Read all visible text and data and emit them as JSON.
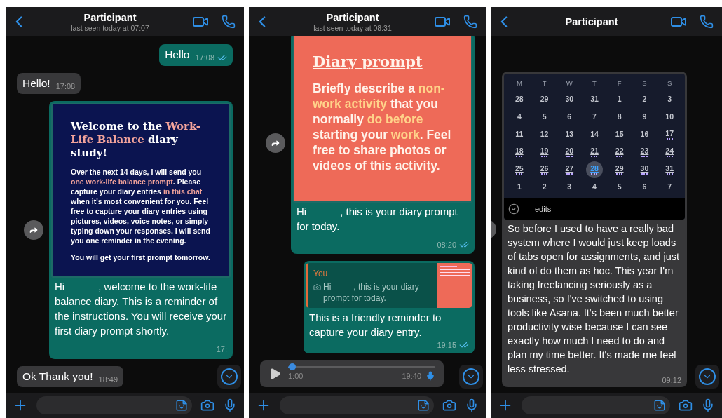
{
  "screens": [
    {
      "header": {
        "title": "Participant",
        "subtitle": "last seen today at 07:07"
      },
      "messages": [
        {
          "kind": "outgoing",
          "text": "Hello",
          "time": "17:08",
          "read": true
        },
        {
          "kind": "incoming",
          "text": "Hello!",
          "time": "17:08"
        },
        {
          "kind": "image",
          "card": {
            "title": [
              {
                "text": "Welcome to the "
              },
              {
                "text": "Work-Life Balance",
                "highlight": true
              },
              {
                "text": " diary study!"
              }
            ],
            "paragraphs": [
              [
                {
                  "text": "Over the next 14 days, I will send you "
                },
                {
                  "text": "one work-life balance prompt",
                  "highlight": true
                },
                {
                  "text": ". Please capture your diary entries "
                },
                {
                  "text": "in this chat",
                  "highlight": true
                },
                {
                  "text": " when it's most convenient for you. Feel free to capture your diary entries using pictures, videos, voice notes, or simply typing down your responses. I will send you one reminder in the evening."
                }
              ],
              [
                {
                  "text": "You will get your first prompt tomorrow."
                }
              ]
            ]
          },
          "caption": [
            "Hi",
            ", welcome to the work-life balance diary. This is a reminder of the instructions. You will receive your first diary prompt shortly."
          ],
          "time": "17:"
        },
        {
          "kind": "incoming",
          "text": "Ok Thank you!",
          "time": "18:49"
        }
      ]
    },
    {
      "header": {
        "title": "Participant",
        "subtitle": "last seen today at 08:31"
      },
      "messages": [
        {
          "kind": "image",
          "card": {
            "title": [
              {
                "text": "Diary prompt"
              }
            ],
            "paragraphs": [
              [
                {
                  "text": "Briefly describe a "
                },
                {
                  "text": "non-work activity",
                  "highlight": true
                },
                {
                  "text": " that you normally "
                },
                {
                  "text": "do before",
                  "highlight": true
                },
                {
                  "text": " starting your "
                },
                {
                  "text": "work",
                  "highlight": true
                },
                {
                  "text": ". Feel free to share photos or videos of this activity."
                }
              ]
            ]
          },
          "caption": [
            "Hi",
            ", this is your diary prompt for today."
          ],
          "time": "08:20",
          "read": true
        },
        {
          "kind": "reply",
          "quote": {
            "author": "You",
            "parts": [
              "Hi",
              ", this is your diary prompt for today."
            ]
          },
          "text": "This is a friendly reminder to capture your diary entry.",
          "time": "19:15",
          "read": true
        },
        {
          "kind": "voice",
          "level": 0.03,
          "duration": "1:00",
          "time": "19:40"
        }
      ]
    },
    {
      "header": {
        "title": "Participant"
      },
      "messages": [
        {
          "kind": "calendar",
          "weekdays": [
            "M",
            "T",
            "W",
            "T",
            "F",
            "S",
            "S"
          ],
          "weeks": [
            [
              {
                "label": "28",
                "marked": false,
                "selected": false
              },
              {
                "label": "29",
                "marked": false,
                "selected": false
              },
              {
                "label": "30",
                "marked": false,
                "selected": false
              },
              {
                "label": "31",
                "marked": false,
                "selected": false
              },
              {
                "label": "1",
                "marked": false,
                "selected": false
              },
              {
                "label": "2",
                "marked": false,
                "selected": false
              },
              {
                "label": "3",
                "marked": false,
                "selected": false
              }
            ],
            [
              {
                "label": "4",
                "marked": false,
                "selected": false
              },
              {
                "label": "5",
                "marked": false,
                "selected": false
              },
              {
                "label": "6",
                "marked": false,
                "selected": false
              },
              {
                "label": "7",
                "marked": false,
                "selected": false
              },
              {
                "label": "8",
                "marked": false,
                "selected": false
              },
              {
                "label": "9",
                "marked": false,
                "selected": false
              },
              {
                "label": "10",
                "marked": false,
                "selected": false
              }
            ],
            [
              {
                "label": "11",
                "marked": false,
                "selected": false
              },
              {
                "label": "12",
                "marked": false,
                "selected": false
              },
              {
                "label": "13",
                "marked": false,
                "selected": false
              },
              {
                "label": "14",
                "marked": false,
                "selected": false
              },
              {
                "label": "15",
                "marked": false,
                "selected": false
              },
              {
                "label": "16",
                "marked": false,
                "selected": false
              },
              {
                "label": "17",
                "marked": true,
                "selected": false
              }
            ],
            [
              {
                "label": "18",
                "marked": true,
                "selected": false
              },
              {
                "label": "19",
                "marked": true,
                "selected": false
              },
              {
                "label": "20",
                "marked": true,
                "selected": false
              },
              {
                "label": "21",
                "marked": true,
                "selected": false
              },
              {
                "label": "22",
                "marked": true,
                "selected": false
              },
              {
                "label": "23",
                "marked": true,
                "selected": false
              },
              {
                "label": "24",
                "marked": true,
                "selected": false
              }
            ],
            [
              {
                "label": "25",
                "marked": true,
                "selected": false
              },
              {
                "label": "26",
                "marked": true,
                "selected": false
              },
              {
                "label": "27",
                "marked": true,
                "selected": false
              },
              {
                "label": "28",
                "marked": true,
                "selected": true
              },
              {
                "label": "29",
                "marked": true,
                "selected": false
              },
              {
                "label": "30",
                "marked": true,
                "selected": false
              },
              {
                "label": "31",
                "marked": true,
                "selected": false
              }
            ],
            [
              {
                "label": "1",
                "marked": false,
                "selected": false
              },
              {
                "label": "2",
                "marked": false,
                "selected": false
              },
              {
                "label": "3",
                "marked": false,
                "selected": false
              },
              {
                "label": "4",
                "marked": false,
                "selected": false
              },
              {
                "label": "5",
                "marked": false,
                "selected": false
              },
              {
                "label": "6",
                "marked": false,
                "selected": false
              },
              {
                "label": "7",
                "marked": false,
                "selected": false
              }
            ]
          ],
          "tasks": [
            {
              "text": "edits",
              "done": true
            }
          ],
          "caption": "So before I used to have a really bad system where I would just keep loads of tabs open for assignments, and just kind of do them as hoc. This year I'm taking freelancing seriously as a business, so I've switched to using tools like Asana. It's been much better productivity wise because I can see exactly how much I need to do and plan my time better. It's made me feel less stressed.",
          "time": "09:12"
        }
      ]
    }
  ]
}
